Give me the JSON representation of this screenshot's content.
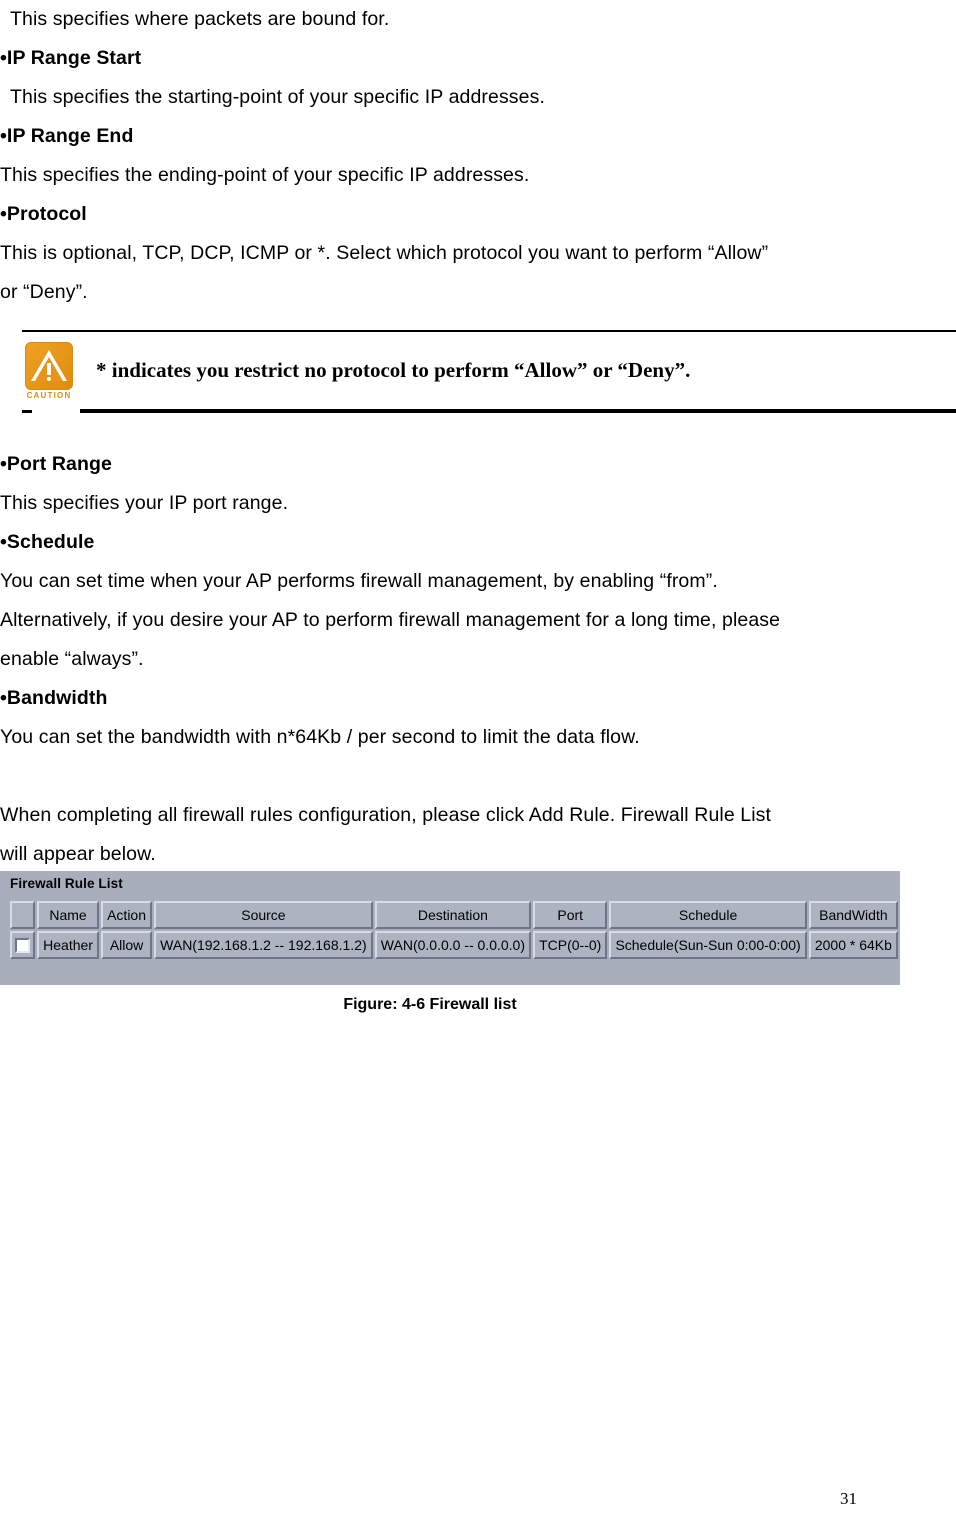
{
  "document": {
    "page_number": "31",
    "body_lines": [
      {
        "text": "This specifies where packets are bound for.",
        "bold": false,
        "indent": true
      },
      {
        "text": "•IP Range Start",
        "bold": true,
        "indent": false
      },
      {
        "text": "This specifies the starting-point of your specific IP addresses.",
        "bold": false,
        "indent": true
      },
      {
        "text": "•IP Range End",
        "bold": true,
        "indent": false
      },
      {
        "text": "This specifies the ending-point of your specific IP addresses.",
        "bold": false,
        "indent": false
      },
      {
        "text": "•Protocol",
        "bold": true,
        "indent": false
      },
      {
        "text": "This is optional, TCP, DCP, ICMP or *. Select which protocol you want to perform “Allow”",
        "bold": false,
        "indent": false
      },
      {
        "text": "or “Deny”.",
        "bold": false,
        "indent": false
      }
    ],
    "body_lines_2": [
      {
        "text": "•Port Range",
        "bold": true,
        "indent": false
      },
      {
        "text": "This specifies your IP port range.",
        "bold": false,
        "indent": false
      },
      {
        "text": "•Schedule",
        "bold": true,
        "indent": false
      },
      {
        "text": "You can set time when your AP performs firewall management, by enabling “from”.",
        "bold": false,
        "indent": false
      },
      {
        "text": "Alternatively, if you desire your AP to perform firewall management for a long time, please",
        "bold": false,
        "indent": false
      },
      {
        "text": "enable “always”.",
        "bold": false,
        "indent": false
      },
      {
        "text": "•Bandwidth",
        "bold": true,
        "indent": false
      },
      {
        "text": "You can set the bandwidth with n*64Kb / per second to limit the data flow.",
        "bold": false,
        "indent": false
      },
      {
        "text": "",
        "bold": false,
        "indent": false
      },
      {
        "text": "When completing all firewall rules configuration, please click Add Rule. Firewall Rule List",
        "bold": false,
        "indent": false
      },
      {
        "text": "will appear below.",
        "bold": false,
        "indent": false
      }
    ]
  },
  "caution": {
    "icon_name": "caution-triangle-icon",
    "icon_label": "CAUTION",
    "accent_color": "#e8941a",
    "text": "* indicates you restrict no protocol to perform “Allow” or “Deny”."
  },
  "firewall_panel": {
    "title": "Firewall Rule List",
    "background_color": "#a9aebd",
    "columns": [
      "",
      "Name",
      "Action",
      "Source",
      "Destination",
      "Port",
      "Schedule",
      "BandWidth"
    ],
    "rows": [
      {
        "selected": false,
        "name": "Heather",
        "action": "Allow",
        "source": "WAN(192.168.1.2 -- 192.168.1.2)",
        "destination": "WAN(0.0.0.0 -- 0.0.0.0)",
        "port": "TCP(0--0)",
        "schedule": "Schedule(Sun-Sun 0:00-0:00)",
        "bandwidth": "2000 * 64Kb"
      }
    ]
  },
  "figure": {
    "caption": "Figure: 4-6 Firewall list"
  }
}
